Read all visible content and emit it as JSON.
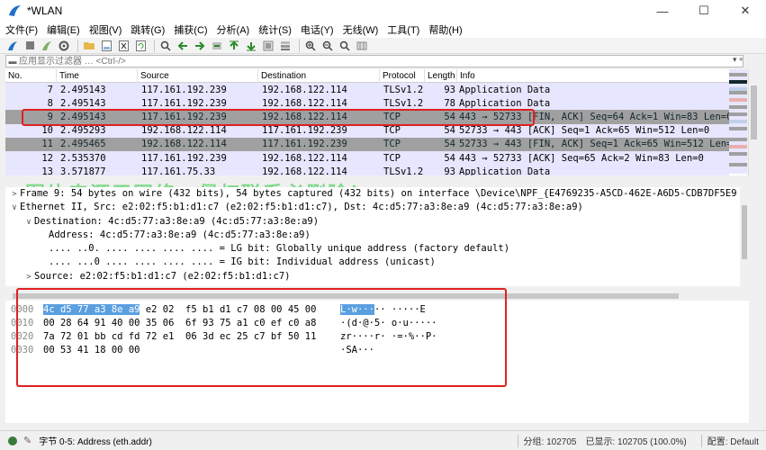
{
  "window": {
    "title": "*WLAN",
    "min_label": "—",
    "max_label": "☐",
    "close_label": "✕"
  },
  "menu": [
    "文件(F)",
    "编辑(E)",
    "视图(V)",
    "跳转(G)",
    "捕获(C)",
    "分析(A)",
    "统计(S)",
    "电话(Y)",
    "无线(W)",
    "工具(T)",
    "帮助(H)"
  ],
  "filter": {
    "placeholder": "应用显示过滤器 … <Ctrl-/>"
  },
  "columns": [
    "No.",
    "Time",
    "Source",
    "Destination",
    "Protocol",
    "Length",
    "Info"
  ],
  "packets": [
    {
      "no": "7",
      "time": "2.495143",
      "src": "117.161.192.239",
      "dst": "192.168.122.114",
      "proto": "TLSv1.2",
      "len": "93",
      "info": "Application Data",
      "style": "row-tls"
    },
    {
      "no": "8",
      "time": "2.495143",
      "src": "117.161.192.239",
      "dst": "192.168.122.114",
      "proto": "TLSv1.2",
      "len": "78",
      "info": "Application Data",
      "style": "row-tls"
    },
    {
      "no": "9",
      "time": "2.495143",
      "src": "117.161.192.239",
      "dst": "192.168.122.114",
      "proto": "TCP",
      "len": "54",
      "info": "443 → 52733 [FIN, ACK] Seq=64 Ack=1 Win=83 Len=0",
      "style": "row-sel"
    },
    {
      "no": "10",
      "time": "2.495293",
      "src": "192.168.122.114",
      "dst": "117.161.192.239",
      "proto": "TCP",
      "len": "54",
      "info": "52733 → 443 [ACK] Seq=1 Ack=65 Win=512 Len=0",
      "style": "row-tls"
    },
    {
      "no": "11",
      "time": "2.495465",
      "src": "192.168.122.114",
      "dst": "117.161.192.239",
      "proto": "TCP",
      "len": "54",
      "info": "52733 → 443 [FIN, ACK] Seq=1 Ack=65 Win=512 Len=0",
      "style": "row-dark"
    },
    {
      "no": "12",
      "time": "2.535370",
      "src": "117.161.192.239",
      "dst": "192.168.122.114",
      "proto": "TCP",
      "len": "54",
      "info": "443 → 52733 [ACK] Seq=65 Ack=2 Win=83 Len=0",
      "style": "row-tls"
    },
    {
      "no": "13",
      "time": "3.571877",
      "src": "117.161.75.33",
      "dst": "192.168.122.114",
      "proto": "TLSv1.2",
      "len": "93",
      "info": "Application Data",
      "style": "row-tls"
    }
  ],
  "details": [
    {
      "tw": ">",
      "indent": 0,
      "text": "Frame 9: 54 bytes on wire (432 bits), 54 bytes captured (432 bits) on interface \\Device\\NPF_{E4769235-A5CD-462E-A6D5-CDB7DF5E9",
      "sel": false
    },
    {
      "tw": "∨",
      "indent": 0,
      "text": "Ethernet II, Src: e2:02:f5:b1:d1:c7 (e2:02:f5:b1:d1:c7), Dst: 4c:d5:77:a3:8e:a9 (4c:d5:77:a3:8e:a9)",
      "sel": false
    },
    {
      "tw": "∨",
      "indent": 1,
      "text": "Destination: 4c:d5:77:a3:8e:a9 (4c:d5:77:a3:8e:a9)",
      "sel": false
    },
    {
      "tw": "",
      "indent": 2,
      "text": "Address: 4c:d5:77:a3:8e:a9 (4c:d5:77:a3:8e:a9)",
      "sel": false
    },
    {
      "tw": "",
      "indent": 2,
      "text": ".... ..0. .... .... .... .... = LG bit: Globally unique address (factory default)",
      "sel": false
    },
    {
      "tw": "",
      "indent": 2,
      "text": ".... ...0 .... .... .... .... = IG bit: Individual address (unicast)",
      "sel": false
    },
    {
      "tw": ">",
      "indent": 1,
      "text": "Source: e2:02:f5:b1:d1:c7 (e2:02:f5:b1:d1:c7)",
      "sel": false
    }
  ],
  "bytes": [
    {
      "off": "0000",
      "hex_hl": "4c d5 77 a3 8e a9",
      "hex": " e2 02  f5 b1 d1 c7 08 00 45 00",
      "asc_hl": "L·w···",
      "asc": "·· ·····E"
    },
    {
      "off": "0010",
      "hex_hl": "",
      "hex": "00 28 64 91 40 00 35 06  6f 93 75 a1 c0 ef c0 a8",
      "asc_hl": "",
      "asc": "·(d·@·5· o·u·····"
    },
    {
      "off": "0020",
      "hex_hl": "",
      "hex": "7a 72 01 bb cd fd 72 e1  06 3d ec 25 c7 bf 50 11",
      "asc_hl": "",
      "asc": "zr····r· ·=·%··P·"
    },
    {
      "off": "0030",
      "hex_hl": "",
      "hex": "00 53 41 18 00 00",
      "asc_hl": "",
      "asc": "·SA···"
    }
  ],
  "watermark": "图片来源于网络，侵权联系必删除！",
  "status": {
    "left": "字节 0-5: Address (eth.addr)",
    "packets": "分组: 102705",
    "displayed": "已显示: 102705 (100.0%)",
    "profile": "配置: Default"
  },
  "colors": {
    "accent": "#1e6fc8",
    "selected_row": "#a0a0a0",
    "tls_row": "#e7e6ff",
    "byte_hl": "#5a9fe0",
    "annotation": "#e02020"
  }
}
